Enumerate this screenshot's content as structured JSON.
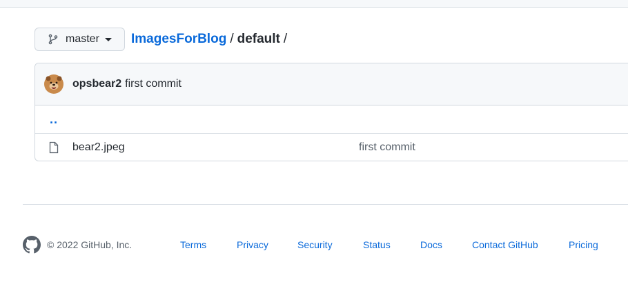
{
  "branch": {
    "name": "master"
  },
  "breadcrumb": {
    "repo": "ImagesForBlog",
    "sep1": "/",
    "dir": "default",
    "sep2": "/"
  },
  "latest_commit": {
    "author": "opsbear2",
    "message": "first commit"
  },
  "files": [
    {
      "type": "parent",
      "name": ".."
    },
    {
      "type": "file",
      "name": "bear2.jpeg",
      "commit": "first commit"
    }
  ],
  "footer": {
    "copyright": "© 2022 GitHub, Inc.",
    "links": [
      "Terms",
      "Privacy",
      "Security",
      "Status",
      "Docs",
      "Contact GitHub",
      "Pricing"
    ]
  },
  "colors": {
    "link": "#0969da",
    "text": "#24292f",
    "muted": "#57606a",
    "border": "#d0d7de"
  },
  "icons": {
    "branch": "git-branch-icon",
    "file": "file-icon",
    "github": "github-mark-icon"
  }
}
